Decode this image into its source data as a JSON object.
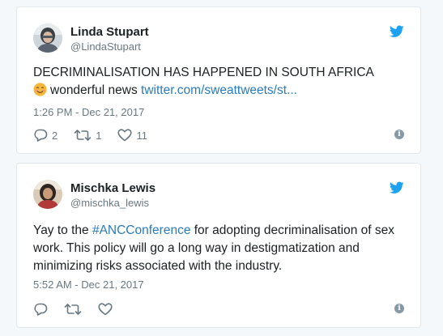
{
  "colors": {
    "background": "#f5f8fa",
    "card": "#ffffff",
    "border": "#e1e8ed",
    "text": "#1c2022",
    "secondary": "#697882",
    "link": "#2b7bb9",
    "twitter_blue": "#1da1f2"
  },
  "tweets": [
    {
      "author_name": "Linda Stupart",
      "author_handle": "@LindaStupart",
      "text_line1": "DECRIMINALISATION HAS HAPPENED IN SOUTH AFRICA",
      "emoji_icon": "smiling-face-emoji",
      "text_line2_prefix": "wonderful news ",
      "link_text": "twitter.com/sweattweets/st...",
      "timestamp": "1:26 PM - Dec 21, 2017",
      "reply_count": "2",
      "retweet_count": "1",
      "like_count": "11"
    },
    {
      "author_name": "Mischka Lewis",
      "author_handle": "@mischka_lewis",
      "text_prefix": "Yay to the ",
      "hashtag": "#ANCConference",
      "text_suffix": " for adopting decriminalisation of sex work. This policy will go a long way in destigmatization and minimizing risks associated with the industry.",
      "timestamp": "5:52 AM - Dec 21, 2017",
      "reply_count": "",
      "retweet_count": "",
      "like_count": ""
    }
  ],
  "icons": {
    "bird": "twitter-bird-icon",
    "reply": "reply-icon",
    "retweet": "retweet-icon",
    "like": "heart-icon",
    "info": "info-icon",
    "info_glyph": "i"
  }
}
